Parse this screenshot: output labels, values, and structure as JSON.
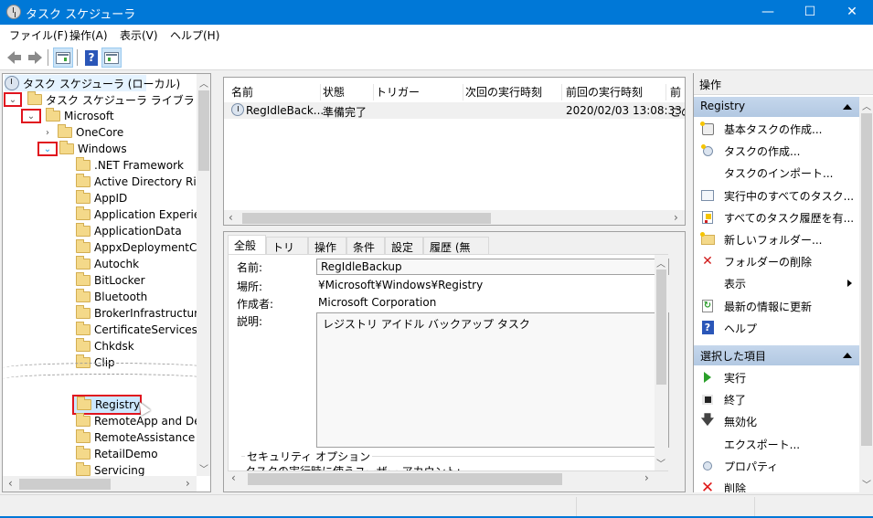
{
  "window": {
    "title": "タスク スケジューラ",
    "controls": {
      "minimize": "—",
      "maximize": "☐",
      "close": "✕"
    }
  },
  "menu": [
    "ファイル(F)",
    "操作(A)",
    "表示(V)",
    "ヘルプ(H)"
  ],
  "toolbar": {
    "buttons": [
      "back",
      "forward",
      "show-hide-console-tree",
      "help",
      "show-hide-action-pane"
    ]
  },
  "tree": {
    "root": "タスク スケジューラ (ローカル)",
    "library": "タスク スケジューラ ライブラリ",
    "microsoft": "Microsoft",
    "onecore": "OneCore",
    "windows": "Windows",
    "children_top": [
      ".NET Framework",
      "Active Directory Righ",
      "AppID",
      "Application Experienc",
      "ApplicationData",
      "AppxDeploymentClie",
      "Autochk",
      "BitLocker",
      "Bluetooth",
      "BrokerInfrastructure",
      "CertificateServicesClie",
      "Chkdsk",
      "Clip"
    ],
    "selected": "Registry",
    "children_bottom": [
      "RemoteApp and Desk",
      "RemoteAssistance",
      "RetailDemo",
      "Servicing"
    ]
  },
  "task_list": {
    "columns": [
      "名前",
      "状態",
      "トリガー",
      "次回の実行時刻",
      "前回の実行時刻",
      "前回"
    ],
    "rows": [
      {
        "name": "RegIdleBack...",
        "status": "準備完了",
        "trigger": "",
        "next_run": "",
        "last_run": "2020/02/03 13:08:33",
        "last_result": "この"
      }
    ]
  },
  "details": {
    "tabs": [
      "全般",
      "トリガー",
      "操作",
      "条件",
      "設定",
      "履歴 (無効)"
    ],
    "active_tab": "全般",
    "name_label": "名前:",
    "name_value": "RegIdleBackup",
    "location_label": "場所:",
    "location_value": "¥Microsoft¥Windows¥Registry",
    "author_label": "作成者:",
    "author_value": "Microsoft Corporation",
    "description_label": "説明:",
    "description_value": "レジストリ アイドル バックアップ タスク",
    "security_group": "セキュリティ オプション",
    "security_partial": "タスクの実行時に使うユーザー アカウント:"
  },
  "actions": {
    "title": "操作",
    "section1": {
      "header": "Registry",
      "items": [
        {
          "label": "基本タスクの作成...",
          "icon": "create-basic-task-icon"
        },
        {
          "label": "タスクの作成...",
          "icon": "create-task-icon"
        },
        {
          "label": "タスクのインポート...",
          "icon": ""
        },
        {
          "label": "実行中のすべてのタスク...",
          "icon": "running-tasks-icon"
        },
        {
          "label": "すべてのタスク履歴を有...",
          "icon": "task-history-icon"
        },
        {
          "label": "新しいフォルダー...",
          "icon": "new-folder-icon"
        },
        {
          "label": "フォルダーの削除",
          "icon": "delete-folder-icon"
        },
        {
          "label": "表示",
          "icon": ""
        },
        {
          "label": "最新の情報に更新",
          "icon": "refresh-icon"
        },
        {
          "label": "ヘルプ",
          "icon": "help-icon"
        }
      ]
    },
    "section2": {
      "header": "選択した項目",
      "items": [
        {
          "label": "実行",
          "icon": "run-icon"
        },
        {
          "label": "終了",
          "icon": "stop-icon"
        },
        {
          "label": "無効化",
          "icon": "disable-icon"
        },
        {
          "label": "エクスポート...",
          "icon": ""
        },
        {
          "label": "プロパティ",
          "icon": "properties-icon"
        },
        {
          "label": "削除",
          "icon": "delete-icon"
        }
      ]
    }
  },
  "colors": {
    "titlebar": "#0078d7",
    "highlight": "#e0141e",
    "selection": "#cce8ff",
    "section_header": "#b8cce4"
  }
}
